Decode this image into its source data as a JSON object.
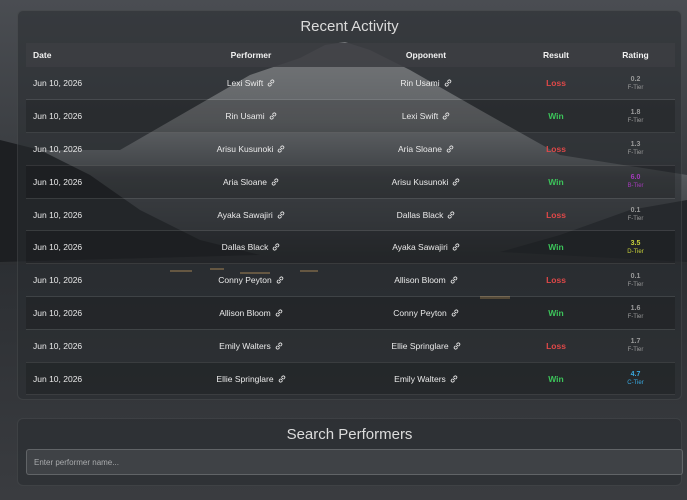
{
  "activity": {
    "title": "Recent Activity",
    "columns": {
      "date": "Date",
      "performer": "Performer",
      "opponent": "Opponent",
      "result": "Result",
      "rating": "Rating"
    },
    "rows": [
      {
        "date": "Jun 10, 2026",
        "performer": "Lexi Swift",
        "opponent": "Rin Usami",
        "result": "Loss",
        "rating": "0.2",
        "tier": "F-Tier",
        "rating_color": "#9a9a9a"
      },
      {
        "date": "Jun 10, 2026",
        "performer": "Rin Usami",
        "opponent": "Lexi Swift",
        "result": "Win",
        "rating": "1.8",
        "tier": "F-Tier",
        "rating_color": "#9a9a9a"
      },
      {
        "date": "Jun 10, 2026",
        "performer": "Arisu Kusunoki",
        "opponent": "Aria Sloane",
        "result": "Loss",
        "rating": "1.3",
        "tier": "F-Tier",
        "rating_color": "#9a9a9a"
      },
      {
        "date": "Jun 10, 2026",
        "performer": "Aria Sloane",
        "opponent": "Arisu Kusunoki",
        "result": "Win",
        "rating": "6.0",
        "tier": "B-Tier",
        "rating_color": "#a23ab8"
      },
      {
        "date": "Jun 10, 2026",
        "performer": "Ayaka Sawajiri",
        "opponent": "Dallas Black",
        "result": "Loss",
        "rating": "0.1",
        "tier": "F-Tier",
        "rating_color": "#9a9a9a"
      },
      {
        "date": "Jun 10, 2026",
        "performer": "Dallas Black",
        "opponent": "Ayaka Sawajiri",
        "result": "Win",
        "rating": "3.5",
        "tier": "D-Tier",
        "rating_color": "#c9d23a"
      },
      {
        "date": "Jun 10, 2026",
        "performer": "Conny Peyton",
        "opponent": "Allison Bloom",
        "result": "Loss",
        "rating": "0.1",
        "tier": "F-Tier",
        "rating_color": "#9a9a9a"
      },
      {
        "date": "Jun 10, 2026",
        "performer": "Allison Bloom",
        "opponent": "Conny Peyton",
        "result": "Win",
        "rating": "1.6",
        "tier": "F-Tier",
        "rating_color": "#9a9a9a"
      },
      {
        "date": "Jun 10, 2026",
        "performer": "Emily Walters",
        "opponent": "Ellie Springlare",
        "result": "Loss",
        "rating": "1.7",
        "tier": "F-Tier",
        "rating_color": "#9a9a9a"
      },
      {
        "date": "Jun 10, 2026",
        "performer": "Ellie Springlare",
        "opponent": "Emily Walters",
        "result": "Win",
        "rating": "4.7",
        "tier": "C-Tier",
        "rating_color": "#3aa9e0"
      }
    ]
  },
  "search": {
    "title": "Search Performers",
    "placeholder": "Enter performer name..."
  },
  "colors": {
    "loss": "#e04848",
    "win": "#3cc45a",
    "panel": "#282b2f"
  },
  "icons": {
    "link": "link-icon"
  }
}
